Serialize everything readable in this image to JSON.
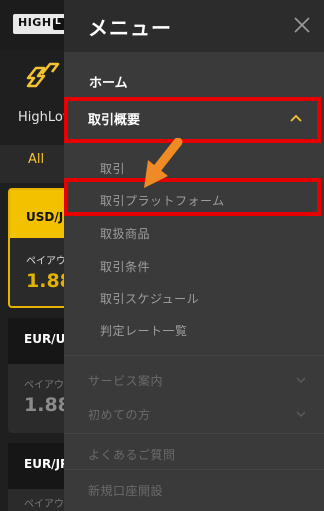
{
  "background": {
    "logo_text": "HIGH",
    "logo_badge": "L",
    "brand_label": "HighLow",
    "tab_label": "All",
    "cards": [
      {
        "pair": "USD/J",
        "payout_label": "ペイアウ",
        "value": "1.88"
      },
      {
        "pair": "EUR/US",
        "payout_label": "ペイアウ",
        "value": "1.88"
      },
      {
        "pair": "EUR/JP",
        "payout_label": "ペイアウ",
        "value": ""
      }
    ]
  },
  "drawer": {
    "title": "メニュー",
    "home": "ホーム",
    "overview": "取引概要",
    "sub_items": [
      "取引",
      "取引プラットフォーム",
      "取扱商品",
      "取引条件",
      "取引スケジュール",
      "判定レート一覧"
    ],
    "sections": [
      "サービス案内",
      "初めての方",
      "よくあるご質問",
      "新規口座開設"
    ]
  },
  "colors": {
    "accent": "#f4c430",
    "highlight": "#e60000",
    "arrow": "#f08a24"
  }
}
